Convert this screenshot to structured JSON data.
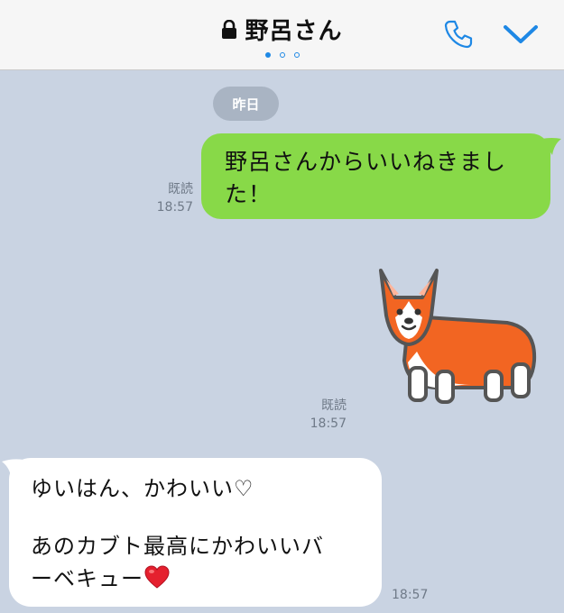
{
  "header": {
    "title": "野呂さん",
    "lock_icon": "lock-icon",
    "call_icon": "phone-icon",
    "menu_icon": "chevron-down-icon",
    "page_dots": {
      "total": 3,
      "active_index": 0
    },
    "accent_color": "#1e88e5"
  },
  "chat": {
    "date_label": "昨日",
    "messages": [
      {
        "direction": "sent",
        "lines": [
          "野呂さんからいいねきまし",
          "た！"
        ],
        "read_label": "既読",
        "time": "18:57",
        "bubble_color": "#88d948"
      },
      {
        "direction": "sent",
        "type": "sticker",
        "sticker_icon": "corgi-sticker-icon",
        "read_label": "既読",
        "time": "18:57"
      },
      {
        "direction": "received",
        "lines": [
          "ゆいはん、かわいい♡",
          "",
          "あのカブト最高にかわいいバ",
          "ーベキュー"
        ],
        "trailing_icon": "heart-icon",
        "time": "18:57",
        "bubble_color": "#ffffff"
      }
    ]
  },
  "colors": {
    "background": "#c9d3e2",
    "header_background": "#f6f6f6",
    "date_pill": "#a9b4c3"
  }
}
